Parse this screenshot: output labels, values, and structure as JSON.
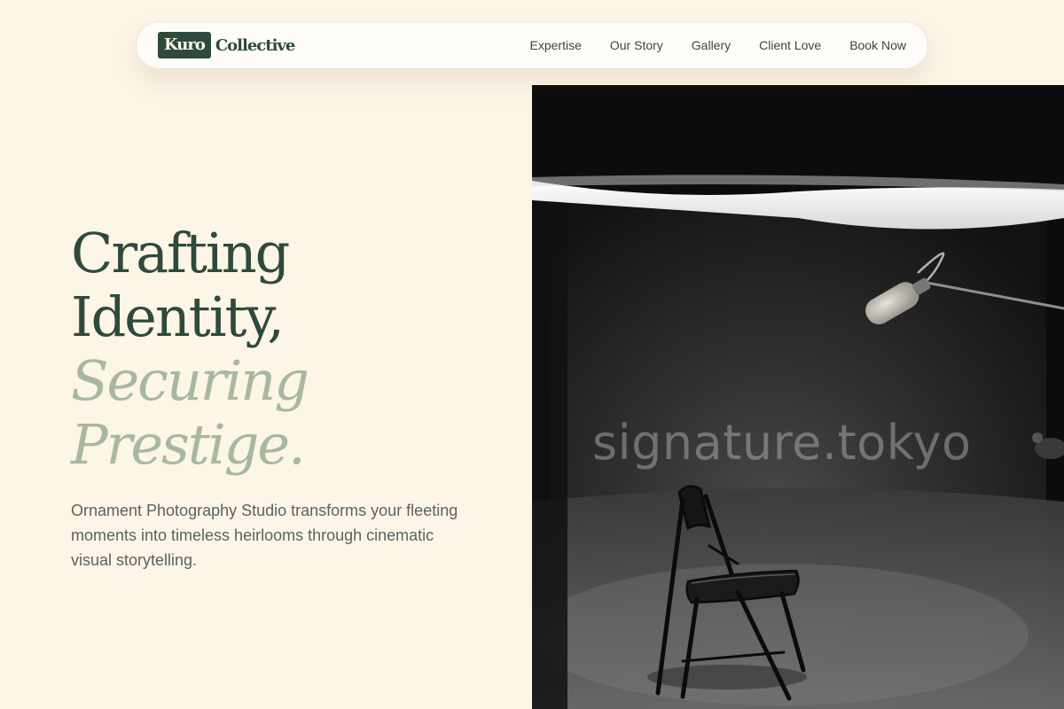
{
  "brand": {
    "mark": "Kuro",
    "name": "Collective"
  },
  "nav": {
    "links": [
      {
        "label": "Expertise"
      },
      {
        "label": "Our Story"
      },
      {
        "label": "Gallery"
      },
      {
        "label": "Client Love"
      },
      {
        "label": "Book Now"
      }
    ]
  },
  "hero": {
    "title_line1": "Crafting",
    "title_line2": "Identity,",
    "title_line3": "Securing",
    "title_line4": "Prestige.",
    "description": "Ornament Photography Studio transforms your fleeting moments into timeless heirlooms through cinematic visual storytelling."
  },
  "photo": {
    "watermark": "signature.tokyo"
  },
  "colors": {
    "background": "#fdf5e6",
    "brand_green": "#2e4a3d",
    "sage": "#a8b89d",
    "body_text": "#596460"
  }
}
